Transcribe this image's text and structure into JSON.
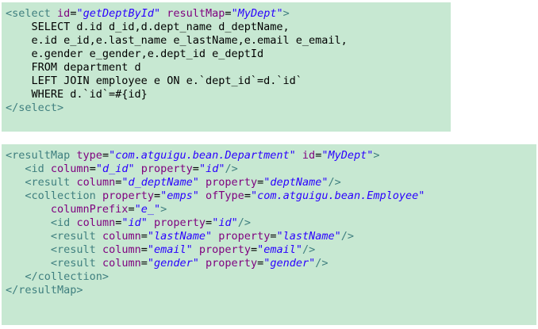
{
  "colors": {
    "block_background": "#c7e8d2",
    "tag": "#3f7f7f",
    "attribute": "#7f007f",
    "value": "#2a00ff",
    "text": "#000000"
  },
  "blocks": [
    {
      "name": "select-statement-block",
      "lines": [
        [
          {
            "t": "tag",
            "s": "<select"
          },
          {
            "t": "text",
            "s": " "
          },
          {
            "t": "attr",
            "s": "id"
          },
          {
            "t": "eq",
            "s": "="
          },
          {
            "t": "val",
            "s": "\"getDeptById\""
          },
          {
            "t": "text",
            "s": " "
          },
          {
            "t": "attr",
            "s": "resultMap"
          },
          {
            "t": "eq",
            "s": "="
          },
          {
            "t": "val",
            "s": "\"MyDept\""
          },
          {
            "t": "tag",
            "s": ">"
          }
        ],
        [
          {
            "t": "text",
            "s": "    SELECT d.id d_id,d.dept_name d_deptName,"
          }
        ],
        [
          {
            "t": "text",
            "s": "    e.id e_id,e.last_name e_lastName,e.email e_email,"
          }
        ],
        [
          {
            "t": "text",
            "s": "    e.gender e_gender,e.dept_id e_deptId"
          }
        ],
        [
          {
            "t": "text",
            "s": "    FROM department d"
          }
        ],
        [
          {
            "t": "text",
            "s": "    LEFT JOIN employee e ON e.`dept_id`=d.`id`"
          }
        ],
        [
          {
            "t": "text",
            "s": "    WHERE d.`id`=#{id}"
          }
        ],
        [
          {
            "t": "tag",
            "s": "</select>"
          }
        ]
      ]
    },
    {
      "name": "result-map-block",
      "lines": [
        [
          {
            "t": "tag",
            "s": "<resultMap"
          },
          {
            "t": "text",
            "s": " "
          },
          {
            "t": "attr",
            "s": "type"
          },
          {
            "t": "eq",
            "s": "="
          },
          {
            "t": "val",
            "s": "\"com.atguigu.bean.Department\""
          },
          {
            "t": "text",
            "s": " "
          },
          {
            "t": "attr",
            "s": "id"
          },
          {
            "t": "eq",
            "s": "="
          },
          {
            "t": "val",
            "s": "\"MyDept\""
          },
          {
            "t": "tag",
            "s": ">"
          }
        ],
        [
          {
            "t": "text",
            "s": "   "
          },
          {
            "t": "tag",
            "s": "<id"
          },
          {
            "t": "text",
            "s": " "
          },
          {
            "t": "attr",
            "s": "column"
          },
          {
            "t": "eq",
            "s": "="
          },
          {
            "t": "val",
            "s": "\"d_id\""
          },
          {
            "t": "text",
            "s": " "
          },
          {
            "t": "attr",
            "s": "property"
          },
          {
            "t": "eq",
            "s": "="
          },
          {
            "t": "val",
            "s": "\"id\""
          },
          {
            "t": "tag",
            "s": "/>"
          }
        ],
        [
          {
            "t": "text",
            "s": "   "
          },
          {
            "t": "tag",
            "s": "<result"
          },
          {
            "t": "text",
            "s": " "
          },
          {
            "t": "attr",
            "s": "column"
          },
          {
            "t": "eq",
            "s": "="
          },
          {
            "t": "val",
            "s": "\"d_deptName\""
          },
          {
            "t": "text",
            "s": " "
          },
          {
            "t": "attr",
            "s": "property"
          },
          {
            "t": "eq",
            "s": "="
          },
          {
            "t": "val",
            "s": "\"deptName\""
          },
          {
            "t": "tag",
            "s": "/>"
          }
        ],
        [
          {
            "t": "text",
            "s": "   "
          },
          {
            "t": "tag",
            "s": "<collection"
          },
          {
            "t": "text",
            "s": " "
          },
          {
            "t": "attr",
            "s": "property"
          },
          {
            "t": "eq",
            "s": "="
          },
          {
            "t": "val",
            "s": "\"emps\""
          },
          {
            "t": "text",
            "s": " "
          },
          {
            "t": "attr",
            "s": "ofType"
          },
          {
            "t": "eq",
            "s": "="
          },
          {
            "t": "val",
            "s": "\"com.atguigu.bean.Employee\""
          }
        ],
        [
          {
            "t": "text",
            "s": "       "
          },
          {
            "t": "attr",
            "s": "columnPrefix"
          },
          {
            "t": "eq",
            "s": "="
          },
          {
            "t": "val",
            "s": "\"e_\""
          },
          {
            "t": "tag",
            "s": ">"
          }
        ],
        [
          {
            "t": "text",
            "s": "       "
          },
          {
            "t": "tag",
            "s": "<id"
          },
          {
            "t": "text",
            "s": " "
          },
          {
            "t": "attr",
            "s": "column"
          },
          {
            "t": "eq",
            "s": "="
          },
          {
            "t": "val",
            "s": "\"id\""
          },
          {
            "t": "text",
            "s": " "
          },
          {
            "t": "attr",
            "s": "property"
          },
          {
            "t": "eq",
            "s": "="
          },
          {
            "t": "val",
            "s": "\"id\""
          },
          {
            "t": "tag",
            "s": "/>"
          }
        ],
        [
          {
            "t": "text",
            "s": "       "
          },
          {
            "t": "tag",
            "s": "<result"
          },
          {
            "t": "text",
            "s": " "
          },
          {
            "t": "attr",
            "s": "column"
          },
          {
            "t": "eq",
            "s": "="
          },
          {
            "t": "val",
            "s": "\"lastName\""
          },
          {
            "t": "text",
            "s": " "
          },
          {
            "t": "attr",
            "s": "property"
          },
          {
            "t": "eq",
            "s": "="
          },
          {
            "t": "val",
            "s": "\"lastName\""
          },
          {
            "t": "tag",
            "s": "/>"
          }
        ],
        [
          {
            "t": "text",
            "s": "       "
          },
          {
            "t": "tag",
            "s": "<result"
          },
          {
            "t": "text",
            "s": " "
          },
          {
            "t": "attr",
            "s": "column"
          },
          {
            "t": "eq",
            "s": "="
          },
          {
            "t": "val",
            "s": "\"email\""
          },
          {
            "t": "text",
            "s": " "
          },
          {
            "t": "attr",
            "s": "property"
          },
          {
            "t": "eq",
            "s": "="
          },
          {
            "t": "val",
            "s": "\"email\""
          },
          {
            "t": "tag",
            "s": "/>"
          }
        ],
        [
          {
            "t": "text",
            "s": "       "
          },
          {
            "t": "tag",
            "s": "<result"
          },
          {
            "t": "text",
            "s": " "
          },
          {
            "t": "attr",
            "s": "column"
          },
          {
            "t": "eq",
            "s": "="
          },
          {
            "t": "val",
            "s": "\"gender\""
          },
          {
            "t": "text",
            "s": " "
          },
          {
            "t": "attr",
            "s": "property"
          },
          {
            "t": "eq",
            "s": "="
          },
          {
            "t": "val",
            "s": "\"gender\""
          },
          {
            "t": "tag",
            "s": "/>"
          }
        ],
        [
          {
            "t": "text",
            "s": "   "
          },
          {
            "t": "tag",
            "s": "</collection>"
          }
        ],
        [
          {
            "t": "tag",
            "s": "</resultMap>"
          }
        ]
      ]
    }
  ]
}
